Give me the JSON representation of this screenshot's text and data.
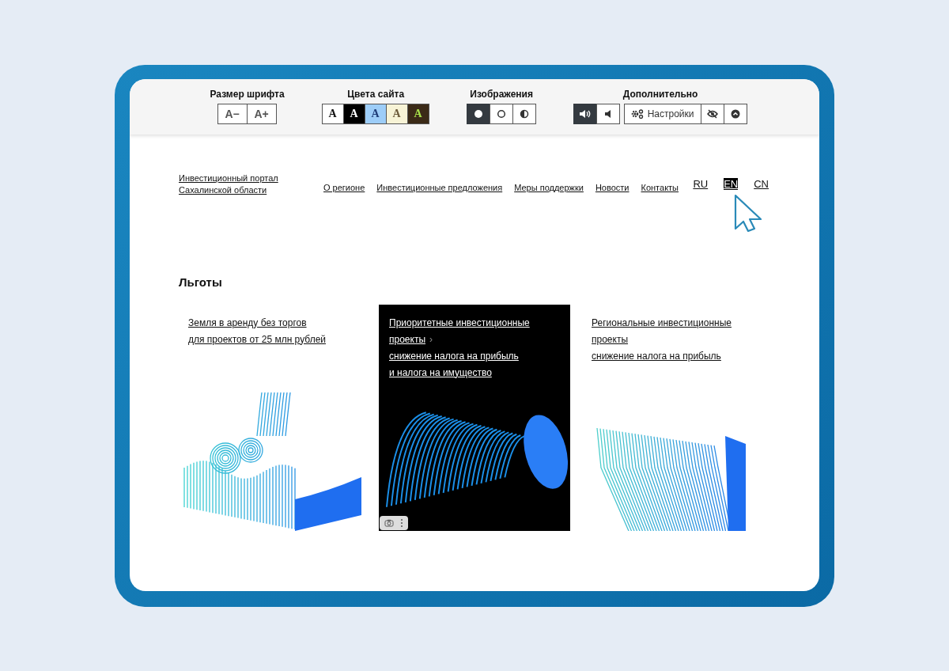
{
  "accessibility_bar": {
    "font_size": {
      "title": "Размер шрифта",
      "buttons": [
        "A−",
        "A+"
      ]
    },
    "site_colors": {
      "title": "Цвета сайта",
      "swatches": [
        {
          "label": "A",
          "color": "#ffffff",
          "kind": "dark"
        },
        {
          "label": "A",
          "color": "#000000",
          "kind": "white"
        },
        {
          "label": "A",
          "color": "#9dcdf8",
          "kind": "navy"
        },
        {
          "label": "A",
          "color": "#f7f3d6",
          "kind": "brown"
        },
        {
          "label": "A",
          "color": "#3b2a17",
          "kind": "green"
        }
      ]
    },
    "images": {
      "title": "Изображения",
      "options": [
        {
          "kind": "on",
          "selected": true
        },
        {
          "kind": "off",
          "selected": false
        },
        {
          "kind": "grayscale",
          "selected": false
        }
      ]
    },
    "extra": {
      "title": "Дополнительно",
      "sound": [
        {
          "kind": "loud",
          "selected": true
        },
        {
          "kind": "quiet",
          "selected": false
        }
      ],
      "settings_label": "Настройки"
    }
  },
  "header": {
    "logo_lines": [
      "Инвестиционный портал",
      "Сахалинской области"
    ],
    "nav": [
      "О регионе",
      "Инвестиционные предложения",
      "Меры поддержки",
      "Новости",
      "Контакты"
    ],
    "languages": [
      {
        "label": "RU",
        "selected": false
      },
      {
        "label": "EN",
        "selected": true
      },
      {
        "label": "CN",
        "selected": false
      }
    ]
  },
  "section_title": "Льготы",
  "cards": [
    {
      "title_lines": [
        "Земля в аренду без торгов"
      ],
      "lines": [
        "для проектов от 25 млн рублей"
      ],
      "selected": false,
      "kind": "terrain"
    },
    {
      "title_lines": [
        "Приоритетные инвестиционные",
        "проекты"
      ],
      "arrow": "›",
      "lines": [
        "снижение налога на прибыль",
        "и налога на имущество"
      ],
      "selected": true,
      "kind": "tunnel"
    },
    {
      "title_lines": [
        "Региональные инвестиционные",
        "проекты"
      ],
      "lines": [
        "снижение налога на прибыль"
      ],
      "selected": false,
      "kind": "slabs"
    }
  ]
}
